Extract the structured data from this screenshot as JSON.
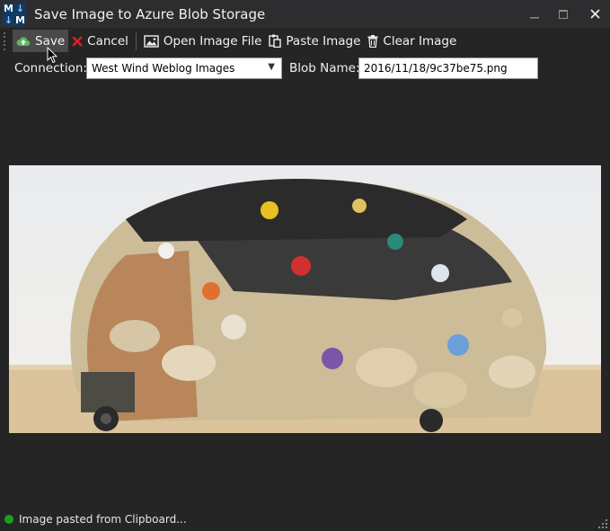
{
  "window": {
    "title": "Save Image to Azure Blob Storage",
    "logo_letters": [
      "M",
      "↓",
      "↓",
      "M"
    ]
  },
  "toolbar": {
    "save_label": "Save",
    "cancel_label": "Cancel",
    "open_label": "Open Image File",
    "paste_label": "Paste Image",
    "clear_label": "Clear Image"
  },
  "form": {
    "connection_label": "Connection:",
    "connection_value": "West Wind Weblog Images",
    "blob_label": "Blob Name:",
    "blob_value": "2016/11/18/9c37be75.png"
  },
  "status": {
    "text": "Image pasted from Clipboard...",
    "color": "#1aa11a"
  },
  "icons": {
    "save": "cloud-upload-icon",
    "cancel": "red-x-icon",
    "open": "picture-icon",
    "paste": "paste-icon",
    "clear": "trash-icon"
  }
}
